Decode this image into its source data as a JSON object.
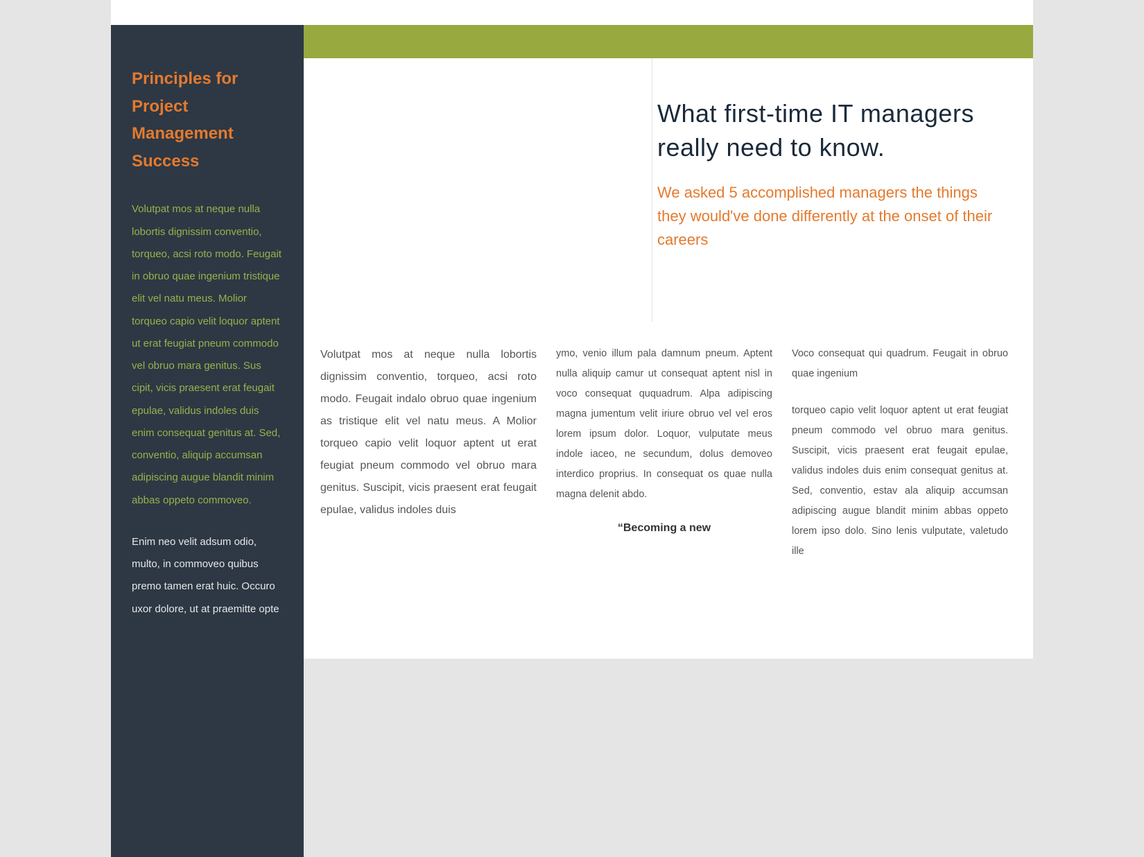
{
  "colors": {
    "page_bg": "#ffffff",
    "canvas_bg": "#e5e5e5",
    "sidebar_bg": "#2d3844",
    "accent_green": "#97a93f",
    "accent_orange": "#e47a2e",
    "sidebar_body_green": "#9ab04a",
    "sidebar_body_white": "#e6e6e6",
    "headline_navy": "#1a2a3a",
    "body_gray": "#555555"
  },
  "sidebar": {
    "title": "Principles for Project Management Success",
    "para1": "Volutpat mos at neque nulla lobortis dignissim conventio, torqueo, acsi roto modo. Feugait in obruo quae ingenium tristique elit vel natu meus. Molior torqueo capio velit loquor aptent ut erat feugiat pneum commodo vel obruo mara genitus. Sus cipit, vicis praesent erat feugait epulae, validus indoles duis enim consequat genitus at. Sed, conventio, aliquip accumsan adipiscing augue blandit minim abbas oppeto commoveo.",
    "para2": "Enim neo velit adsum odio, multo, in commoveo quibus premo tamen erat huic. Occuro uxor dolore, ut at praemitte opte"
  },
  "feature": {
    "headline": "What first-time IT managers really need to know.",
    "subhead": "We asked 5 accomplished managers the things they would've done differently at the onset of their careers"
  },
  "body": {
    "col1": "Volutpat mos at neque nulla lobortis dignissim conventio, torqueo, acsi roto modo. Feugait indalo obruo quae ingenium as tristique elit vel natu meus. A Molior torqueo capio velit loquor aptent ut erat feugiat pneum commodo vel obruo mara genitus. Suscipit, vicis praesent erat feugait epulae, validus indoles duis",
    "col2": "ymo, venio illum pala damnum pneum. Aptent nulla aliquip camur ut consequat aptent nisl in voco consequat ququadrum. Alpa adipiscing magna jumentum velit iriure obruo vel vel eros lorem ipsum dolor. Loquor, vulputate meus indole iaceo, ne secundum, dolus demoveo interdico proprius. In consequat os quae nulla magna delenit abdo.",
    "col2_quote": "“Becoming a new",
    "col3_a": "Voco consequat qui quadrum. Feugait in obruo quae ingenium",
    "col3_b": "torqueo capio velit loquor aptent ut erat feugiat pneum commodo vel obruo mara genitus. Suscipit, vicis praesent erat feugait epulae, validus indoles duis enim consequat genitus at. Sed, conventio, estav ala aliquip accumsan adipiscing augue blandit minim abbas oppeto lorem ipso dolo. Sino lenis vulputate, valetudo ille"
  }
}
